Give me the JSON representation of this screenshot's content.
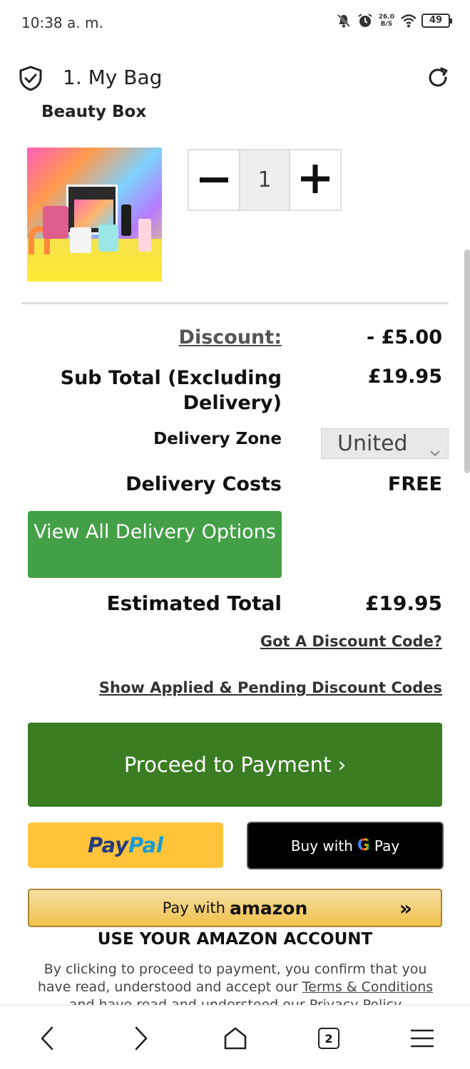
{
  "status_bar": {
    "time": "10:38 a. m.",
    "net_speed_value": "26.0",
    "net_speed_unit": "B/S",
    "battery": "49",
    "icons": [
      "mute-bell-icon",
      "alarm-icon",
      "wifi-icon",
      "battery-icon"
    ]
  },
  "header": {
    "title": "1. My Bag",
    "left_icon": "shield-check-icon",
    "right_icon": "refresh-icon"
  },
  "product": {
    "name": "Beauty Box",
    "quantity": "1",
    "decrease_icon": "minus-icon",
    "increase_icon": "plus-icon"
  },
  "summary": {
    "discount_label": "Discount:",
    "discount_value": "- £5.00",
    "subtotal_label": "Sub Total (Excluding Delivery)",
    "subtotal_value": "£19.95",
    "zone_label": "Delivery Zone",
    "zone_value": "United",
    "costs_label": "Delivery Costs",
    "costs_value": "FREE",
    "view_delivery_label": "View All Delivery Options",
    "estimated_label": "Estimated Total",
    "estimated_value": "£19.95"
  },
  "links": {
    "discount_code": "Got A Discount Code?",
    "show_codes": "Show Applied & Pending Discount Codes"
  },
  "payment": {
    "proceed_label": "Proceed to Payment ›",
    "paypal_part1": "Pay",
    "paypal_part2": "Pal",
    "gpay_prefix": "Buy with",
    "gpay_g": "G",
    "gpay_pay": "Pay",
    "amazon_prefix": "Pay with",
    "amazon_brand": "amazon",
    "amazon_arrows": "»",
    "amazon_note": "USE YOUR AMAZON ACCOUNT",
    "legal_part1": "By clicking to proceed to payment, you confirm that you have read, understood and accept our",
    "legal_link": "Terms & Conditions",
    "legal_part2": "and have read and understood our Privacy Policy"
  },
  "nav": {
    "tab_count": "2",
    "icons": [
      "back-icon",
      "forward-icon",
      "home-icon",
      "tabs-icon",
      "menu-icon"
    ]
  },
  "colors": {
    "green_button": "#43a047",
    "proceed_green": "#3a7d22",
    "paypal_yellow": "#ffc439",
    "amazon_gold": "#f0c14b"
  }
}
